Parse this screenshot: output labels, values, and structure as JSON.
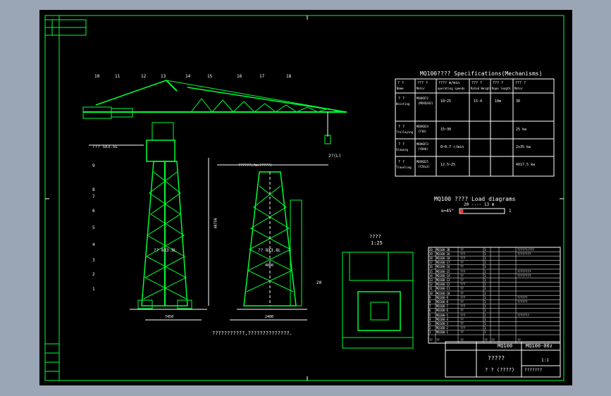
{
  "spec_table": {
    "title": "MQ100???? Specifications(Mechanisms)",
    "headers": [
      "? ?\nName",
      "??? ?\nMotor",
      "???? m/min\noperating speeds",
      "??? ?\nRated Weight",
      "??? ?\nRope length",
      "??? ?\nMotor"
    ],
    "header_labels": [
      "? ?",
      "??? ?",
      "???? m/min",
      "??? ?",
      "??? ?",
      "??? ?"
    ],
    "header_sub": [
      "Name",
      "Motor",
      "operating speeds",
      "Rated Weight",
      "Rope length",
      "Motor"
    ],
    "rows": [
      {
        "name": "? ?",
        "name2": "Hoisting",
        "motor": "MOXKD72",
        "motor2": "(MOXD202)",
        "speed": "10~25",
        "weight": "15-4",
        "rope": "10m",
        "power": "30"
      },
      {
        "name": "? ?",
        "name2": "Trolleying",
        "motor": "MOXKD24",
        "motor2": "(Y38)",
        "speed": "15~30",
        "weight": "",
        "rope": "",
        "power": "25 kw"
      },
      {
        "name": "? ?",
        "name2": "Slewing",
        "motor": "MOXKD73",
        "motor2": "(YD40)",
        "speed": "0~0.7 r/min",
        "weight": "",
        "rope": "",
        "power": "2x35 kw"
      },
      {
        "name": "? ?",
        "name2": "Traveling",
        "motor": "MOXKD25",
        "motor2": "(YZ4x3)",
        "speed": "12.5~25",
        "weight": "",
        "rope": "",
        "power": "4X17.5 kw"
      }
    ]
  },
  "load_diagram": {
    "title": "MQ100 ????  Load diagrams",
    "range": "20 ---- 13 m",
    "left": "α=45°",
    "mid": "3",
    "right": "1"
  },
  "callouts": [
    "10",
    "11",
    "12",
    "13",
    "14",
    "15",
    "16",
    "17",
    "18",
    "9",
    "8",
    "7",
    "6",
    "5",
    "4",
    "3",
    "2",
    "1",
    "20"
  ],
  "dims": {
    "height_label": "40750",
    "jib_radius": "2?(L)",
    "boom_label": "??? 5X3.5L",
    "tower_label": "?? 8X3.8L",
    "front_label": "?? 8X3.8L",
    "span": "??????(?m=?????)",
    "small1": "7450",
    "small2": "2400",
    "small3": "4800"
  },
  "plan_view": {
    "title": "????",
    "scale": "1:25"
  },
  "bom": {
    "rows": [
      [
        "20",
        "MQ100-3B",
        "??",
        "1",
        "",
        "??????/???"
      ],
      [
        "19",
        "MQ100-3A",
        "???",
        "1",
        "",
        "????????"
      ],
      [
        "18",
        "MQ100-18",
        "???",
        "1",
        "",
        ""
      ],
      [
        "17",
        "MQ100-17",
        "??",
        "1",
        "",
        ""
      ],
      [
        "16",
        "MQ100-16",
        "??",
        "1",
        "",
        ""
      ],
      [
        "15",
        "MQ100-15",
        "???",
        "1",
        "",
        "????????"
      ],
      [
        "14",
        "MQ100-14",
        "??",
        "1",
        "",
        "????????"
      ],
      [
        "13",
        "MQ100-13",
        "??",
        "1",
        "",
        ""
      ],
      [
        "12",
        "MQ100-12",
        "???",
        "1",
        "",
        ""
      ],
      [
        "11",
        "MQ100-11",
        "??",
        "1",
        "",
        ""
      ],
      [
        "10",
        "MQ100-10",
        "??",
        "1",
        "",
        ""
      ],
      [
        "9",
        "MQ100-9",
        "???",
        "1",
        "",
        "??????"
      ],
      [
        "8",
        "MQ100-8",
        "??",
        "1",
        "",
        "??????"
      ],
      [
        "7",
        "MQ100-7",
        "???",
        "1",
        "",
        ""
      ],
      [
        "6",
        "MQ100-6",
        "??",
        "1",
        "",
        ""
      ],
      [
        "5",
        "MQ100-5",
        "???",
        "1",
        "",
        "???????"
      ],
      [
        "4",
        "MQ100-4",
        "??",
        "1",
        "",
        ""
      ],
      [
        "3",
        "MQ100-3",
        "??",
        "1",
        "",
        ""
      ],
      [
        "2",
        "MQ100-2",
        "???",
        "1",
        "",
        ""
      ],
      [
        "1",
        "MQ100-1",
        "??",
        "1",
        "",
        ""
      ]
    ],
    "header": [
      "??",
      "??",
      "??",
      "??",
      "??",
      "??"
    ]
  },
  "title_block": {
    "code": "MQ100",
    "drawing_no": "MQ100-00z",
    "name": "?????",
    "scale": "1:1",
    "sheet": "? ? (????)",
    "designer": "???????"
  },
  "notes": "???????????,??????????????.",
  "colors": {
    "line": "#00ff33",
    "text": "#ffffff",
    "dim": "#ff3333",
    "frame": "#00ff33",
    "background": "#000000"
  }
}
